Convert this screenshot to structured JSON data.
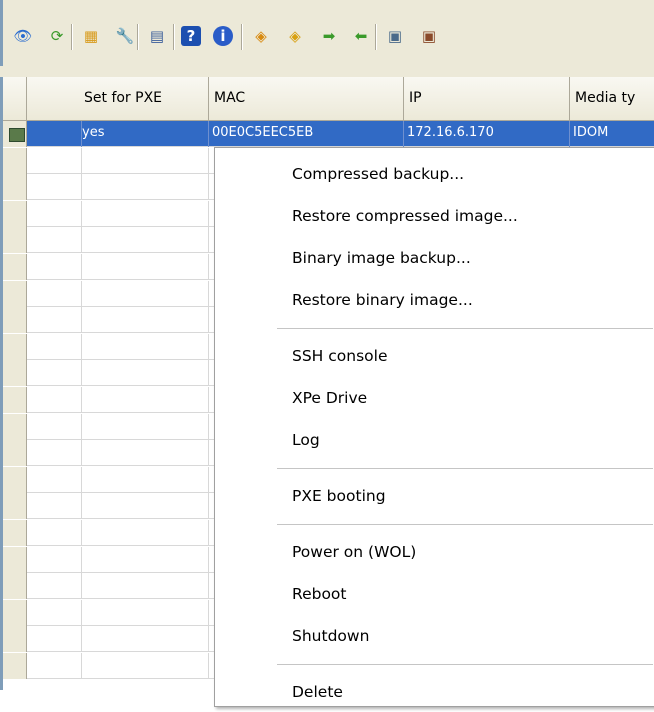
{
  "toolbar": {
    "icons": [
      {
        "name": "view-icon",
        "glyph": "👁",
        "color": "#2a6ccf"
      },
      {
        "name": "refresh-icon",
        "glyph": "⟳",
        "color": "#3a9a2a"
      },
      {
        "name": "properties-icon",
        "glyph": "▦",
        "color": "#d89a1a"
      },
      {
        "name": "tools-icon",
        "glyph": "🔧",
        "color": "#5a7fb8"
      },
      {
        "name": "terminal-icon",
        "glyph": "▤",
        "color": "#3b5e9a"
      },
      {
        "name": "help-icon",
        "glyph": "?",
        "color": "#ffffff"
      },
      {
        "name": "info-icon",
        "glyph": "i",
        "color": "#ffffff"
      },
      {
        "name": "backup-icon",
        "glyph": "◈",
        "color": "#d88a10"
      },
      {
        "name": "restore-icon",
        "glyph": "◈",
        "color": "#d8a010"
      },
      {
        "name": "binary-backup-icon",
        "glyph": "➡",
        "color": "#3a9a2a"
      },
      {
        "name": "binary-restore-icon",
        "glyph": "⬅",
        "color": "#3a9a2a"
      },
      {
        "name": "device-add-icon",
        "glyph": "▣",
        "color": "#4a6a8a"
      },
      {
        "name": "device-remove-icon",
        "glyph": "▣",
        "color": "#8a4a2a"
      }
    ]
  },
  "grid": {
    "columns": [
      "",
      "Set for PXE",
      "MAC",
      "IP",
      "Media ty"
    ],
    "rows": [
      {
        "icon": "computer-icon",
        "set_for_pxe": "yes",
        "mac": "00E0C5EEC5EB",
        "ip": "172.16.6.170",
        "media": "IDOM",
        "selected": true
      }
    ],
    "empty_row_count": 20
  },
  "context_menu": {
    "groups": [
      [
        "Compressed backup...",
        "Restore compressed image...",
        "Binary image backup...",
        "Restore binary image..."
      ],
      [
        "SSH console",
        "XPe Drive",
        "Log"
      ],
      [
        "PXE booting"
      ],
      [
        "Power on (WOL)",
        "Reboot",
        "Shutdown"
      ],
      [
        "Delete"
      ]
    ]
  }
}
